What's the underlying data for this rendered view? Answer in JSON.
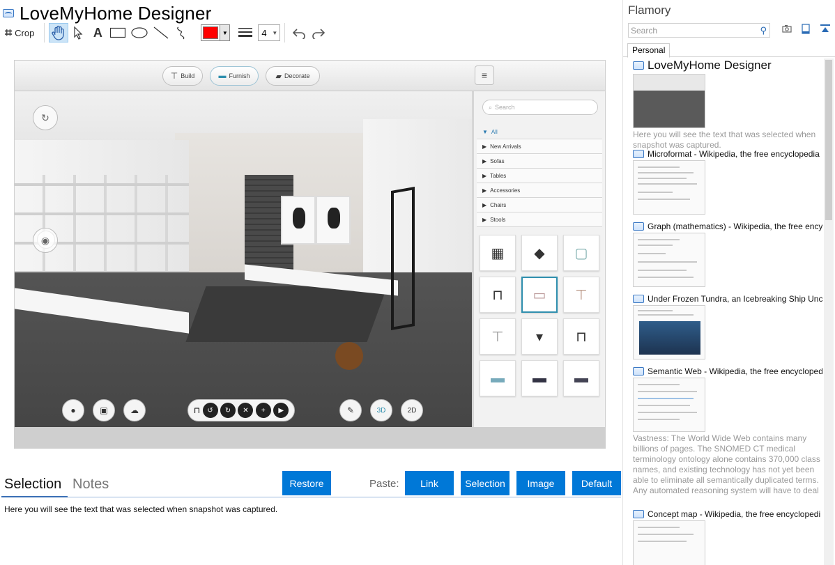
{
  "app": {
    "title": "LoveMyHome Designer"
  },
  "toolbar": {
    "crop_label": "Crop",
    "line_width": "4",
    "color": "#ff0000",
    "icons": [
      "crop-icon",
      "hand-icon",
      "pointer-icon",
      "text-icon",
      "rectangle-icon",
      "ellipse-icon",
      "line-icon",
      "freehand-icon",
      "color-picker",
      "line-width-icon",
      "undo-icon",
      "redo-icon"
    ]
  },
  "snapshot": {
    "tabs": [
      {
        "label": "Build"
      },
      {
        "label": "Furnish"
      },
      {
        "label": "Decorate"
      }
    ],
    "search_placeholder": "Search",
    "categories": [
      {
        "label": "All"
      },
      {
        "label": "New Arrivals"
      },
      {
        "label": "Sofas"
      },
      {
        "label": "Tables"
      },
      {
        "label": "Accessories"
      },
      {
        "label": "Chairs"
      },
      {
        "label": "Stools"
      }
    ],
    "view_3d": "3D",
    "view_2d": "2D"
  },
  "bottom": {
    "tab_selection": "Selection",
    "tab_notes": "Notes",
    "restore_label": "Restore",
    "paste_label": "Paste:",
    "link_label": "Link",
    "selection_label": "Selection",
    "image_label": "Image",
    "default_label": "Default",
    "selection_text": "Here you will see the text that was selected when snapshot was captured."
  },
  "flamory": {
    "title": "Flamory",
    "search_placeholder": "Search",
    "tab_personal": "Personal",
    "items": [
      {
        "title": "LoveMyHome Designer",
        "desc": "Here you will see the text that was selected when snapshot was captured."
      },
      {
        "title": "Microformat - Wikipedia, the free encyclopedia"
      },
      {
        "title": "Graph (mathematics) - Wikipedia, the free ency"
      },
      {
        "title": "Under Frozen Tundra, an Icebreaking Ship Unco"
      },
      {
        "title": "Semantic Web - Wikipedia, the free encycloped",
        "desc": "Vastness: The World Wide Web contains many billions of pages. The SNOMED CT medical terminology ontology alone contains 370,000 class names, and existing technology has not yet been able to eliminate all semantically duplicated terms. Any automated reasoning system will have to deal with truly huge inputs."
      },
      {
        "title": "Concept map - Wikipedia, the free encyclopedi"
      }
    ]
  }
}
